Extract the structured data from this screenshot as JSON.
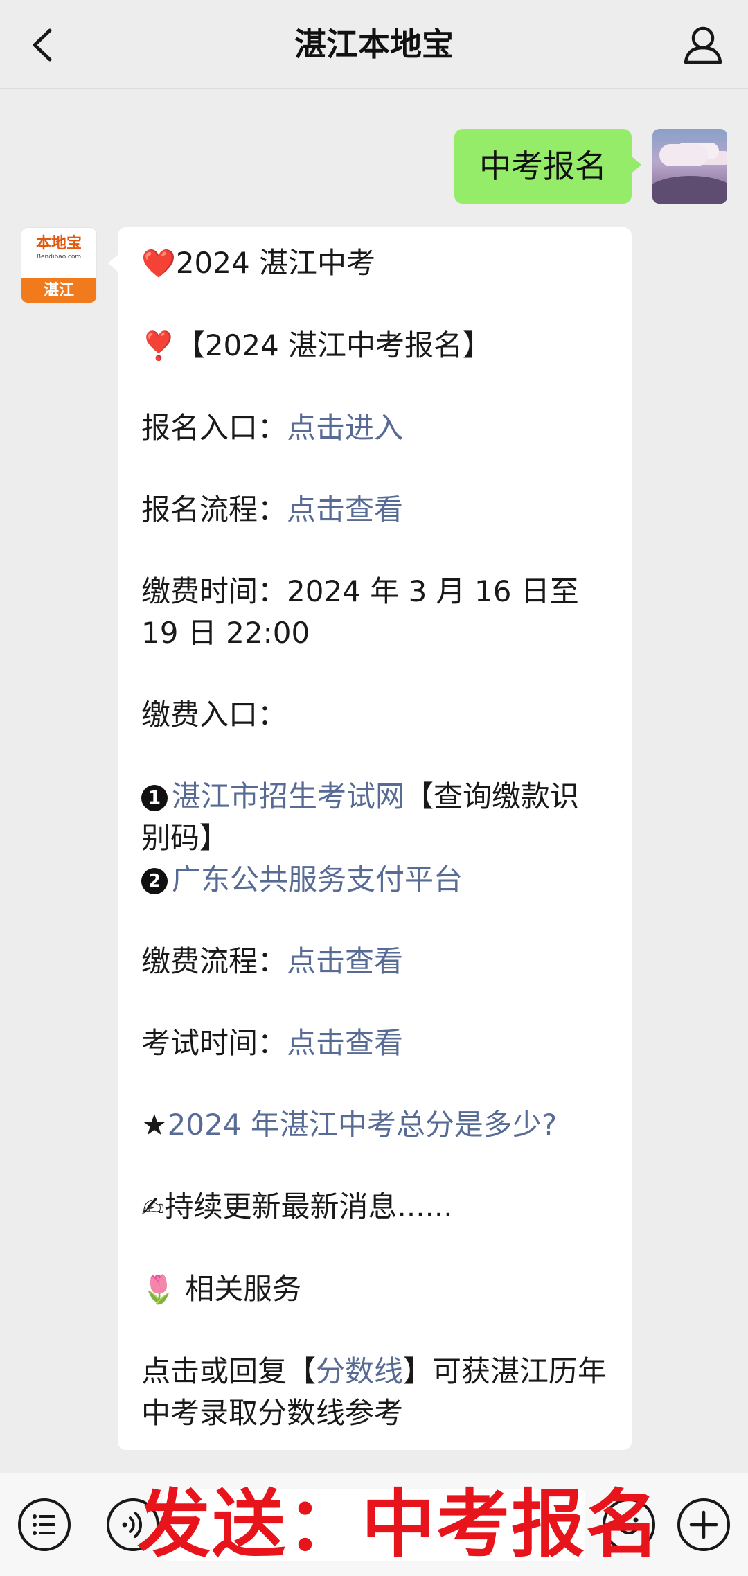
{
  "header": {
    "title": "湛江本地宝"
  },
  "outgoing": {
    "text": "中考报名"
  },
  "bot_avatar": {
    "logo_cn": "本地宝",
    "logo_en": "Bendibao.com",
    "city": "湛江"
  },
  "reply": {
    "heading_emoji": "❤️",
    "heading": "2024 湛江中考",
    "section_emoji": "❣️",
    "section": "【2024 湛江中考报名】",
    "reg_entry_label": "报名入口：",
    "reg_entry_link": "点击进入",
    "reg_flow_label": "报名流程：",
    "reg_flow_link": "点击查看",
    "fee_time": "缴费时间：2024 年 3 月 16 日至 19 日 22:00",
    "fee_entry_label": "缴费入口：",
    "item1_num": "1",
    "item1_link": "湛江市招生考试网",
    "item1_suffix": "【查询缴款识别码】",
    "item2_num": "2",
    "item2_link": "广东公共服务支付平台",
    "fee_flow_label": "缴费流程：",
    "fee_flow_link": "点击查看",
    "exam_time_label": "考试时间：",
    "exam_time_link": "点击查看",
    "star": "★",
    "score_link": "2024 年湛江中考总分是多少?",
    "update_emoji": "✍",
    "update_text": "持续更新最新消息......",
    "service_emoji": "🌷",
    "service_text": " 相关服务",
    "tail_prefix": "点击或回复【",
    "tail_link": "分数线",
    "tail_suffix": "】可获湛江历年中考录取分数线参考"
  },
  "overlay": {
    "text": "发送：中考报名"
  },
  "colors": {
    "outgoing_bubble": "#95ec69",
    "link": "#576b95",
    "overlay_text": "#e8141c",
    "background": "#ededed"
  },
  "icons": [
    "back-icon",
    "profile-icon",
    "menu-list-icon",
    "voice-icon",
    "emoji-icon",
    "plus-icon"
  ]
}
